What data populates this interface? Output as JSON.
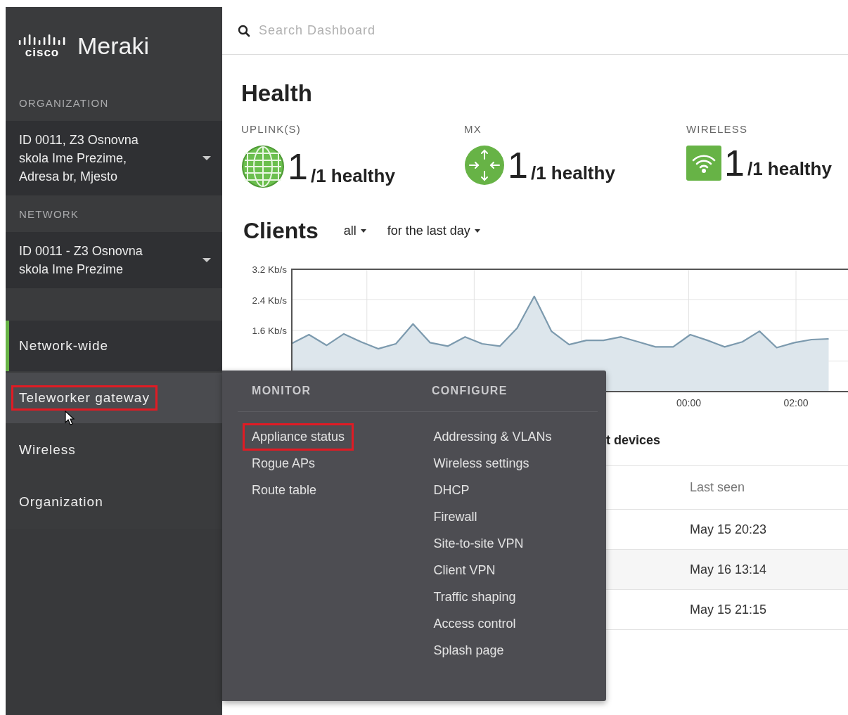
{
  "sidebar": {
    "logo": {
      "wordmark": "cisco",
      "product": "Meraki"
    },
    "organization": {
      "label": "ORGANIZATION",
      "value": "ID 0011, Z3 Osnovna skola Ime Prezime, Adresa br, Mjesto"
    },
    "network": {
      "label": "NETWORK",
      "value": "ID 0011 - Z3 Osnovna skola Ime Prezime"
    },
    "nav_items": [
      {
        "label": "Network-wide",
        "selected": true,
        "expanded": false,
        "highlighted": false
      },
      {
        "label": "Teleworker gateway",
        "selected": false,
        "expanded": true,
        "highlighted": true
      },
      {
        "label": "Wireless",
        "selected": false,
        "expanded": false,
        "highlighted": false
      },
      {
        "label": "Organization",
        "selected": false,
        "expanded": false,
        "highlighted": false
      }
    ]
  },
  "search": {
    "placeholder": "Search Dashboard"
  },
  "health": {
    "title": "Health",
    "metrics": [
      {
        "label": "UPLINK(S)",
        "count": "1",
        "total": "/1 healthy"
      },
      {
        "label": "MX",
        "count": "1",
        "total": "/1 healthy"
      },
      {
        "label": "WIRELESS",
        "count": "1",
        "total": "/1 healthy"
      }
    ]
  },
  "clients": {
    "title": "Clients",
    "filters": [
      "all",
      "for the last day"
    ],
    "chart_data": {
      "type": "area",
      "x": [
        -7.4,
        -7.08,
        -6.75,
        -6.43,
        -6.11,
        -5.79,
        -5.46,
        -5.14,
        -4.82,
        -4.49,
        -4.17,
        -3.85,
        -3.52,
        -3.2,
        -2.88,
        -2.56,
        -2.23,
        -1.91,
        -1.59,
        -1.26,
        -0.94,
        -0.62,
        -0.29,
        0.03,
        0.35,
        0.67,
        1.0,
        1.32,
        1.64,
        1.97,
        2.29,
        2.61
      ],
      "grid": true,
      "series": [
        {
          "color": "#7c9aae",
          "values": [
            1.26,
            1.49,
            1.21,
            1.51,
            1.3,
            1.12,
            1.25,
            1.77,
            1.28,
            1.19,
            1.43,
            1.25,
            1.19,
            1.66,
            2.49,
            1.58,
            1.23,
            1.34,
            1.34,
            1.43,
            1.3,
            1.17,
            1.17,
            1.49,
            1.34,
            1.17,
            1.3,
            1.58,
            1.15,
            1.28,
            1.36,
            1.38
          ]
        }
      ],
      "xlim": [
        -7.4,
        2.97
      ],
      "ylim": [
        0,
        3.2
      ],
      "xticks": [
        {
          "value": 0,
          "label": "00:00"
        },
        {
          "value": 2,
          "label": "02:00"
        }
      ],
      "yticks": [
        {
          "value": 1.6,
          "label": "1.6 Kb/s"
        },
        {
          "value": 2.4,
          "label": "2.4 Kb/s"
        },
        {
          "value": 3.2,
          "label": "3.2 Kb/s"
        }
      ]
    }
  },
  "devices": {
    "title": "t devices",
    "columns": [
      "Last seen"
    ],
    "rows": [
      {
        "last_seen": "May 15 20:23"
      },
      {
        "last_seen": "May 16 13:14"
      },
      {
        "last_seen": "May 15 21:15"
      }
    ]
  },
  "flyout": {
    "columns": [
      {
        "heading": "MONITOR",
        "items": [
          {
            "label": "Appliance status",
            "highlighted": true
          },
          {
            "label": "Rogue APs",
            "highlighted": false
          },
          {
            "label": "Route table",
            "highlighted": false
          }
        ]
      },
      {
        "heading": "CONFIGURE",
        "items": [
          {
            "label": "Addressing & VLANs",
            "highlighted": false
          },
          {
            "label": "Wireless settings",
            "highlighted": false
          },
          {
            "label": "DHCP",
            "highlighted": false
          },
          {
            "label": "Firewall",
            "highlighted": false
          },
          {
            "label": "Site-to-site VPN",
            "highlighted": false
          },
          {
            "label": "Client VPN",
            "highlighted": false
          },
          {
            "label": "Traffic shaping",
            "highlighted": false
          },
          {
            "label": "Access control",
            "highlighted": false
          },
          {
            "label": "Splash page",
            "highlighted": false
          }
        ]
      }
    ]
  }
}
